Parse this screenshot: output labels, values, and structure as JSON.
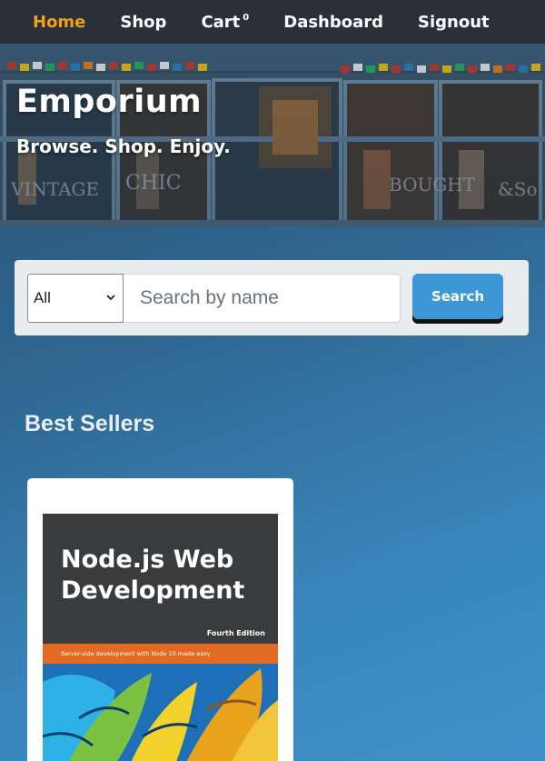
{
  "nav": {
    "items": [
      {
        "label": "Home",
        "active": true
      },
      {
        "label": "Shop",
        "active": false
      },
      {
        "label": "Cart",
        "active": false,
        "badge": "0"
      },
      {
        "label": "Dashboard",
        "active": false
      },
      {
        "label": "Signout",
        "active": false
      }
    ],
    "active_color": "#f0a01a"
  },
  "hero": {
    "title": "Emporium",
    "subtitle": "Browse. Shop. Enjoy."
  },
  "search": {
    "category_selected": "All",
    "placeholder": "Search by name",
    "value": "",
    "button_label": "Search",
    "button_color": "#3d96d6"
  },
  "best_sellers": {
    "heading": "Best Sellers",
    "products": [
      {
        "cover_title": "Node.js Web Development",
        "cover_edition": "Fourth Edition",
        "cover_tagline": "Server-side development with Node 10 made easy"
      }
    ]
  }
}
